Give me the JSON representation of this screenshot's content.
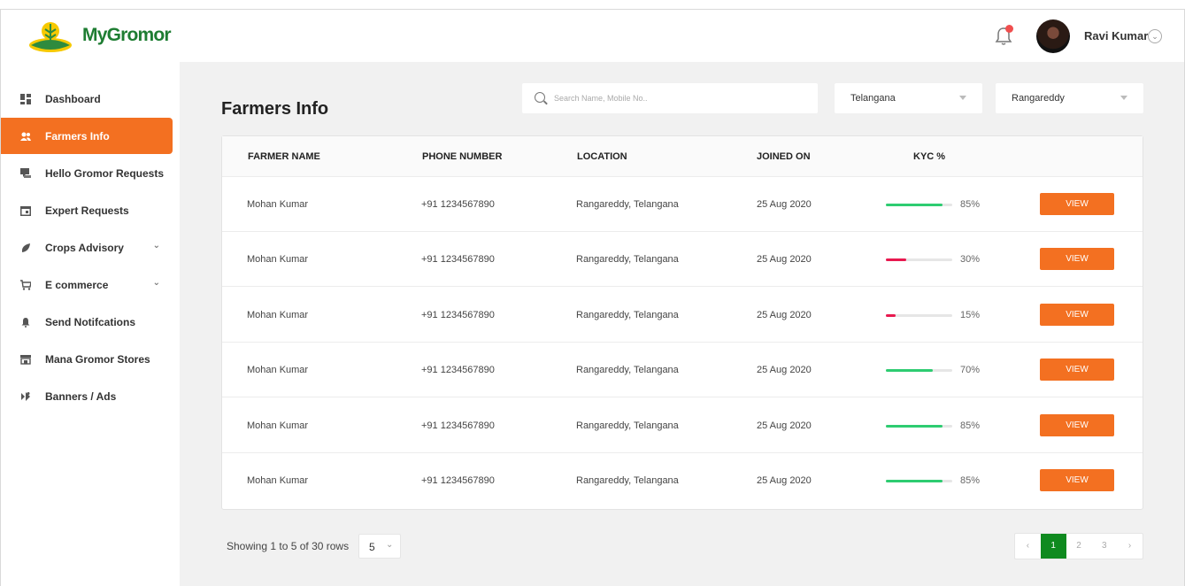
{
  "header": {
    "logo_text": "MyGromor",
    "user_name": "Ravi Kumar",
    "icons": [
      "logo-mark",
      "bell-icon",
      "avatar",
      "chevron-down-icon"
    ]
  },
  "sidebar": {
    "items": [
      {
        "label": "Dashboard",
        "icon": "dashboard-icon"
      },
      {
        "label": "Farmers Info",
        "icon": "users-icon",
        "active": true
      },
      {
        "label": "Hello Gromor Requests",
        "icon": "chat-icon"
      },
      {
        "label": "Expert Requests",
        "icon": "calendar-icon"
      },
      {
        "label": "Crops Advisory",
        "icon": "leaf-icon",
        "expandable": true
      },
      {
        "label": "E commerce",
        "icon": "cart-icon",
        "expandable": true
      },
      {
        "label": "Send Notifcations",
        "icon": "bell-icon"
      },
      {
        "label": "Mana Gromor Stores",
        "icon": "store-icon"
      },
      {
        "label": "Banners  / Ads",
        "icon": "megaphone-icon"
      }
    ]
  },
  "main": {
    "title": "Farmers Info",
    "search": {
      "placeholder": "Search Name, Mobile No.."
    },
    "state_select": "Telangana",
    "district_select": "Rangareddy",
    "table": {
      "columns": [
        "FARMER NAME",
        "PHONE NUMBER",
        "LOCATION",
        "JOINED ON",
        "KYC %"
      ],
      "rows": [
        {
          "name": "Mohan Kumar",
          "phone": "+91 1234567890",
          "location": "Rangareddy, Telangana",
          "joined": "25 Aug 2020",
          "kyc": 85,
          "kyc_label": "85%",
          "kyc_color": "#2ecc71",
          "action": "VIEW"
        },
        {
          "name": "Mohan Kumar",
          "phone": "+91 1234567890",
          "location": "Rangareddy, Telangana",
          "joined": "25 Aug 2020",
          "kyc": 30,
          "kyc_label": "30%",
          "kyc_color": "#e8194f",
          "action": "VIEW"
        },
        {
          "name": "Mohan Kumar",
          "phone": "+91 1234567890",
          "location": "Rangareddy, Telangana",
          "joined": "25 Aug 2020",
          "kyc": 15,
          "kyc_label": "15%",
          "kyc_color": "#e8194f",
          "action": "VIEW"
        },
        {
          "name": "Mohan Kumar",
          "phone": "+91 1234567890",
          "location": "Rangareddy, Telangana",
          "joined": "25 Aug 2020",
          "kyc": 70,
          "kyc_label": "70%",
          "kyc_color": "#2ecc71",
          "action": "VIEW"
        },
        {
          "name": "Mohan Kumar",
          "phone": "+91 1234567890",
          "location": "Rangareddy, Telangana",
          "joined": "25 Aug 2020",
          "kyc": 85,
          "kyc_label": "85%",
          "kyc_color": "#2ecc71",
          "action": "VIEW"
        },
        {
          "name": "Mohan Kumar",
          "phone": "+91 1234567890",
          "location": "Rangareddy, Telangana",
          "joined": "25 Aug 2020",
          "kyc": 85,
          "kyc_label": "85%",
          "kyc_color": "#2ecc71",
          "action": "VIEW"
        }
      ]
    },
    "footer": {
      "showing": "Showing 1 to 5 of 30 rows",
      "rows_per_page": "5",
      "pages": [
        "‹",
        "1",
        "2",
        "3",
        "›"
      ],
      "current_page": "1"
    }
  },
  "colors": {
    "accent": "#f37021",
    "brand_green": "#1e7d32",
    "page_active": "#0f8a1f",
    "kyc_good": "#2ecc71",
    "kyc_low": "#e8194f"
  }
}
